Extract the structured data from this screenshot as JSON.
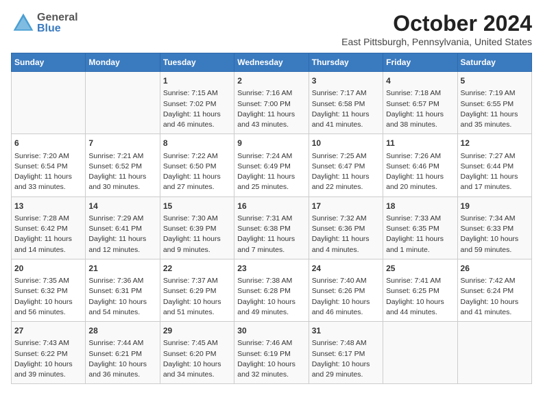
{
  "header": {
    "logo_general": "General",
    "logo_blue": "Blue",
    "month": "October 2024",
    "location": "East Pittsburgh, Pennsylvania, United States"
  },
  "days_of_week": [
    "Sunday",
    "Monday",
    "Tuesday",
    "Wednesday",
    "Thursday",
    "Friday",
    "Saturday"
  ],
  "weeks": [
    [
      {
        "num": "",
        "sunrise": "",
        "sunset": "",
        "daylight": ""
      },
      {
        "num": "",
        "sunrise": "",
        "sunset": "",
        "daylight": ""
      },
      {
        "num": "1",
        "sunrise": "Sunrise: 7:15 AM",
        "sunset": "Sunset: 7:02 PM",
        "daylight": "Daylight: 11 hours and 46 minutes."
      },
      {
        "num": "2",
        "sunrise": "Sunrise: 7:16 AM",
        "sunset": "Sunset: 7:00 PM",
        "daylight": "Daylight: 11 hours and 43 minutes."
      },
      {
        "num": "3",
        "sunrise": "Sunrise: 7:17 AM",
        "sunset": "Sunset: 6:58 PM",
        "daylight": "Daylight: 11 hours and 41 minutes."
      },
      {
        "num": "4",
        "sunrise": "Sunrise: 7:18 AM",
        "sunset": "Sunset: 6:57 PM",
        "daylight": "Daylight: 11 hours and 38 minutes."
      },
      {
        "num": "5",
        "sunrise": "Sunrise: 7:19 AM",
        "sunset": "Sunset: 6:55 PM",
        "daylight": "Daylight: 11 hours and 35 minutes."
      }
    ],
    [
      {
        "num": "6",
        "sunrise": "Sunrise: 7:20 AM",
        "sunset": "Sunset: 6:54 PM",
        "daylight": "Daylight: 11 hours and 33 minutes."
      },
      {
        "num": "7",
        "sunrise": "Sunrise: 7:21 AM",
        "sunset": "Sunset: 6:52 PM",
        "daylight": "Daylight: 11 hours and 30 minutes."
      },
      {
        "num": "8",
        "sunrise": "Sunrise: 7:22 AM",
        "sunset": "Sunset: 6:50 PM",
        "daylight": "Daylight: 11 hours and 27 minutes."
      },
      {
        "num": "9",
        "sunrise": "Sunrise: 7:24 AM",
        "sunset": "Sunset: 6:49 PM",
        "daylight": "Daylight: 11 hours and 25 minutes."
      },
      {
        "num": "10",
        "sunrise": "Sunrise: 7:25 AM",
        "sunset": "Sunset: 6:47 PM",
        "daylight": "Daylight: 11 hours and 22 minutes."
      },
      {
        "num": "11",
        "sunrise": "Sunrise: 7:26 AM",
        "sunset": "Sunset: 6:46 PM",
        "daylight": "Daylight: 11 hours and 20 minutes."
      },
      {
        "num": "12",
        "sunrise": "Sunrise: 7:27 AM",
        "sunset": "Sunset: 6:44 PM",
        "daylight": "Daylight: 11 hours and 17 minutes."
      }
    ],
    [
      {
        "num": "13",
        "sunrise": "Sunrise: 7:28 AM",
        "sunset": "Sunset: 6:42 PM",
        "daylight": "Daylight: 11 hours and 14 minutes."
      },
      {
        "num": "14",
        "sunrise": "Sunrise: 7:29 AM",
        "sunset": "Sunset: 6:41 PM",
        "daylight": "Daylight: 11 hours and 12 minutes."
      },
      {
        "num": "15",
        "sunrise": "Sunrise: 7:30 AM",
        "sunset": "Sunset: 6:39 PM",
        "daylight": "Daylight: 11 hours and 9 minutes."
      },
      {
        "num": "16",
        "sunrise": "Sunrise: 7:31 AM",
        "sunset": "Sunset: 6:38 PM",
        "daylight": "Daylight: 11 hours and 7 minutes."
      },
      {
        "num": "17",
        "sunrise": "Sunrise: 7:32 AM",
        "sunset": "Sunset: 6:36 PM",
        "daylight": "Daylight: 11 hours and 4 minutes."
      },
      {
        "num": "18",
        "sunrise": "Sunrise: 7:33 AM",
        "sunset": "Sunset: 6:35 PM",
        "daylight": "Daylight: 11 hours and 1 minute."
      },
      {
        "num": "19",
        "sunrise": "Sunrise: 7:34 AM",
        "sunset": "Sunset: 6:33 PM",
        "daylight": "Daylight: 10 hours and 59 minutes."
      }
    ],
    [
      {
        "num": "20",
        "sunrise": "Sunrise: 7:35 AM",
        "sunset": "Sunset: 6:32 PM",
        "daylight": "Daylight: 10 hours and 56 minutes."
      },
      {
        "num": "21",
        "sunrise": "Sunrise: 7:36 AM",
        "sunset": "Sunset: 6:31 PM",
        "daylight": "Daylight: 10 hours and 54 minutes."
      },
      {
        "num": "22",
        "sunrise": "Sunrise: 7:37 AM",
        "sunset": "Sunset: 6:29 PM",
        "daylight": "Daylight: 10 hours and 51 minutes."
      },
      {
        "num": "23",
        "sunrise": "Sunrise: 7:38 AM",
        "sunset": "Sunset: 6:28 PM",
        "daylight": "Daylight: 10 hours and 49 minutes."
      },
      {
        "num": "24",
        "sunrise": "Sunrise: 7:40 AM",
        "sunset": "Sunset: 6:26 PM",
        "daylight": "Daylight: 10 hours and 46 minutes."
      },
      {
        "num": "25",
        "sunrise": "Sunrise: 7:41 AM",
        "sunset": "Sunset: 6:25 PM",
        "daylight": "Daylight: 10 hours and 44 minutes."
      },
      {
        "num": "26",
        "sunrise": "Sunrise: 7:42 AM",
        "sunset": "Sunset: 6:24 PM",
        "daylight": "Daylight: 10 hours and 41 minutes."
      }
    ],
    [
      {
        "num": "27",
        "sunrise": "Sunrise: 7:43 AM",
        "sunset": "Sunset: 6:22 PM",
        "daylight": "Daylight: 10 hours and 39 minutes."
      },
      {
        "num": "28",
        "sunrise": "Sunrise: 7:44 AM",
        "sunset": "Sunset: 6:21 PM",
        "daylight": "Daylight: 10 hours and 36 minutes."
      },
      {
        "num": "29",
        "sunrise": "Sunrise: 7:45 AM",
        "sunset": "Sunset: 6:20 PM",
        "daylight": "Daylight: 10 hours and 34 minutes."
      },
      {
        "num": "30",
        "sunrise": "Sunrise: 7:46 AM",
        "sunset": "Sunset: 6:19 PM",
        "daylight": "Daylight: 10 hours and 32 minutes."
      },
      {
        "num": "31",
        "sunrise": "Sunrise: 7:48 AM",
        "sunset": "Sunset: 6:17 PM",
        "daylight": "Daylight: 10 hours and 29 minutes."
      },
      {
        "num": "",
        "sunrise": "",
        "sunset": "",
        "daylight": ""
      },
      {
        "num": "",
        "sunrise": "",
        "sunset": "",
        "daylight": ""
      }
    ]
  ]
}
